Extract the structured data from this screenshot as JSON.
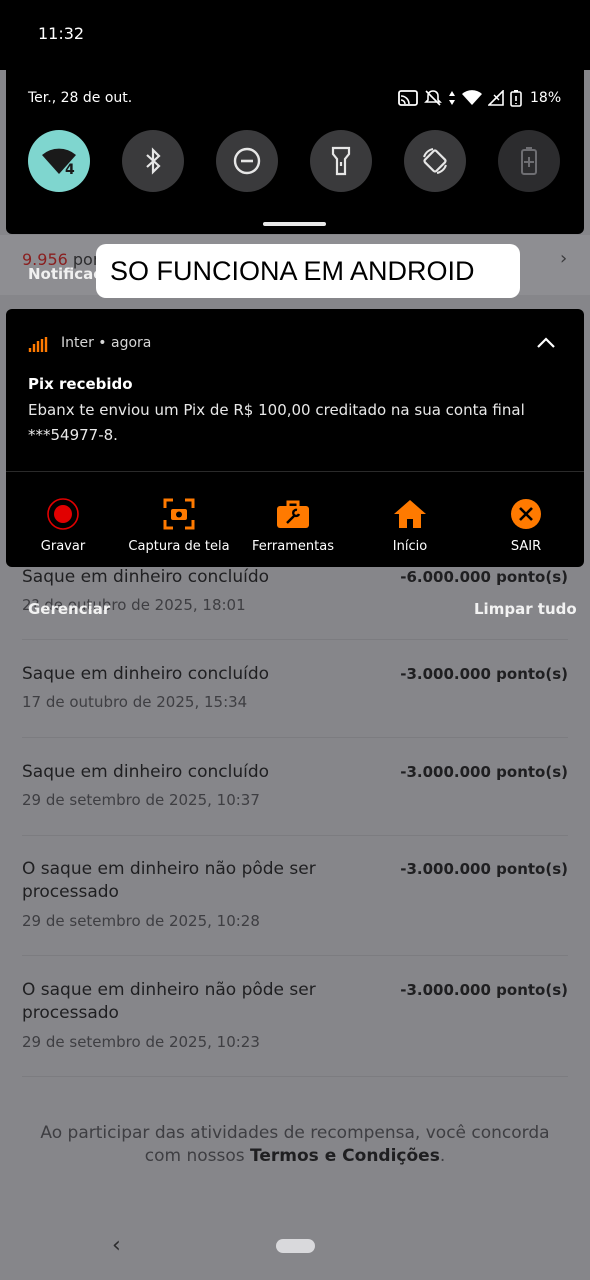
{
  "status_bar": {
    "time": "11:32",
    "date": "Ter., 28 de out.",
    "battery": "18%"
  },
  "quick_settings": [
    {
      "name": "wifi-tile",
      "icon": "wifi-icon",
      "active": true,
      "badge": "4"
    },
    {
      "name": "bluetooth-tile",
      "icon": "bluetooth-icon",
      "active": false
    },
    {
      "name": "do-not-disturb-tile",
      "icon": "do-not-disturb-icon",
      "active": false
    },
    {
      "name": "flashlight-tile",
      "icon": "flashlight-icon",
      "active": false
    },
    {
      "name": "auto-rotate-tile",
      "icon": "auto-rotate-icon",
      "active": false
    },
    {
      "name": "battery-saver-tile",
      "icon": "battery-saver-icon",
      "active": false
    }
  ],
  "banner": {
    "text": "SO FUNCIONA EM ANDROID"
  },
  "notification": {
    "app": "Inter • agora",
    "title": "Pix recebido",
    "body": "Ebanx te enviou um Pix de R$ 100,00 creditado na sua conta final ***54977-8.",
    "actions": [
      {
        "label": "Gravar",
        "icon": "record-icon"
      },
      {
        "label": "Captura de tela",
        "icon": "screenshot-icon"
      },
      {
        "label": "Ferramentas",
        "icon": "tools-icon"
      },
      {
        "label": "Início",
        "icon": "home-icon"
      },
      {
        "label": "SAIR",
        "icon": "close-icon"
      }
    ]
  },
  "shade_controls": {
    "manage": "Gerenciar",
    "clear_all": "Limpar tudo"
  },
  "background": {
    "points_value": "9.956",
    "points_suffix": " pon",
    "notifications_label": "Notificaç",
    "transactions": [
      {
        "title": "Saque em dinheiro concluído",
        "date": "2? de outubro de 2025, 18:01",
        "amount": "-6.000.000 ponto(s)"
      },
      {
        "title": "Saque em dinheiro concluído",
        "date": "17 de outubro de 2025, 15:34",
        "amount": "-3.000.000 ponto(s)"
      },
      {
        "title": "Saque em dinheiro concluído",
        "date": "29 de setembro de 2025, 10:37",
        "amount": "-3.000.000 ponto(s)"
      },
      {
        "title": "O saque em dinheiro não pôde ser processado",
        "date": "29 de setembro de 2025, 10:28",
        "amount": "-3.000.000 ponto(s)"
      },
      {
        "title": "O saque em dinheiro não pôde ser processado",
        "date": "29 de setembro de 2025, 10:23",
        "amount": "-3.000.000 ponto(s)"
      }
    ],
    "footer_prefix": "Ao participar das atividades de recompensa, você concorda com nossos ",
    "footer_link": "Termos e Condições",
    "footer_suffix": "."
  },
  "colors": {
    "accent_orange": "#ff7a00",
    "record_red": "#e10000",
    "wifi_tile": "#7fd6cf"
  }
}
